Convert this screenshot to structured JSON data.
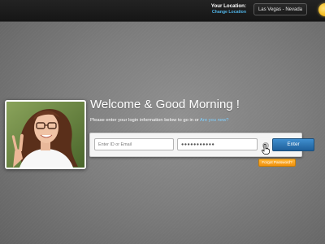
{
  "topbar": {
    "location_label": "Your Location:",
    "change_location": "Change Location",
    "selected_location": "Las Vegas - Nevada",
    "weather_icon": "sun-icon"
  },
  "welcome": {
    "title": "Welcome & Good Morning !",
    "instructions": "Please enter your login information below to go in or",
    "new_user_link": "Are you new?"
  },
  "login": {
    "username_placeholder": "Enter ID or Email",
    "password_value": "●●●●●●●●●●●",
    "enter_label": "Enter",
    "forgot_label": "Forgot Password?"
  },
  "colors": {
    "accent_blue": "#2b77b7",
    "link_blue": "#4fb3e6",
    "forgot_orange": "#f5a11f",
    "topbar_bg": "#1c1c1c"
  }
}
